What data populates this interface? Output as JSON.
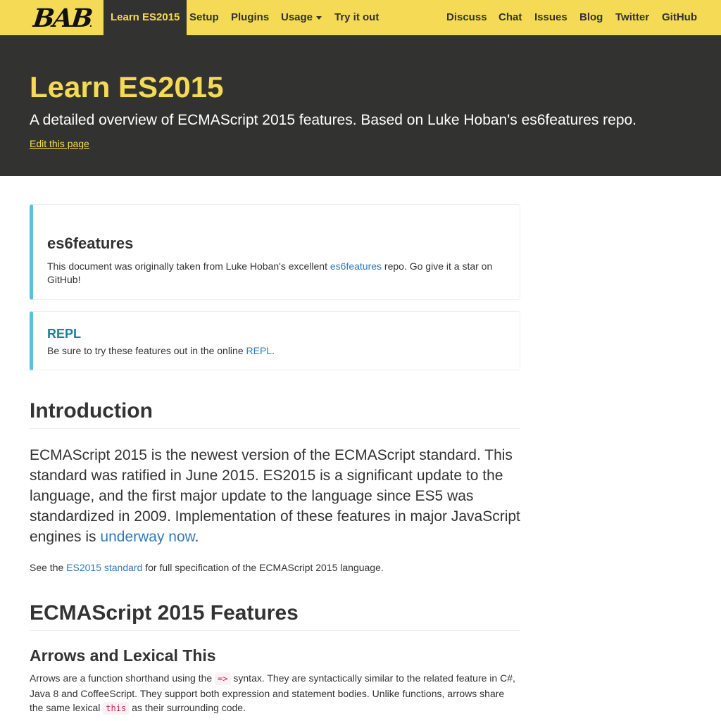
{
  "navbar": {
    "brand": "BABEL",
    "left_items": [
      {
        "label": "Learn ES2015"
      },
      {
        "label": "Setup"
      },
      {
        "label": "Plugins"
      },
      {
        "label": "Usage"
      },
      {
        "label": "Try it out"
      }
    ],
    "right_items": [
      {
        "label": "Discuss"
      },
      {
        "label": "Chat"
      },
      {
        "label": "Issues"
      },
      {
        "label": "Blog"
      },
      {
        "label": "Twitter"
      },
      {
        "label": "GitHub"
      }
    ]
  },
  "header": {
    "title": "Learn ES2015",
    "lead": "A detailed overview of ECMAScript 2015 features. Based on Luke Hoban's es6features repo.",
    "edit_link": "Edit this page"
  },
  "callout_es6": {
    "title": "es6features",
    "text_before": "This document was originally taken from Luke Hoban's excellent ",
    "link": "es6features",
    "text_after": " repo. Go give it a star on GitHub!"
  },
  "callout_repl": {
    "title": "REPL",
    "text_before": "Be sure to try these features out in the online ",
    "link": "REPL",
    "text_after": "."
  },
  "introduction": {
    "heading": "Introduction",
    "lead_before": "ECMAScript 2015 is the newest version of the ECMAScript standard. This standard was ratified in June 2015. ES2015 is a significant update to the language, and the first major update to the language since ES5 was standardized in 2009. Implementation of these features in major JavaScript engines is ",
    "lead_link": "underway now",
    "lead_after": ".",
    "see_before": "See the ",
    "see_link": "ES2015 standard",
    "see_after": " for full specification of the ECMAScript 2015 language."
  },
  "features": {
    "heading": "ECMAScript 2015 Features",
    "arrows": {
      "heading": "Arrows and Lexical This",
      "text_1": "Arrows are a function shorthand using the ",
      "code_1": "=>",
      "text_2": " syntax. They are syntactically similar to the related feature in C#, Java 8 and CoffeeScript. They support both expression and statement bodies. Unlike functions, arrows share the same lexical ",
      "code_2": "this",
      "text_3": " as their surrounding code."
    }
  },
  "colors": {
    "brand_yellow": "#f5da55",
    "dark": "#323330",
    "link": "#337ab7",
    "callout_border": "#5bc0de"
  }
}
